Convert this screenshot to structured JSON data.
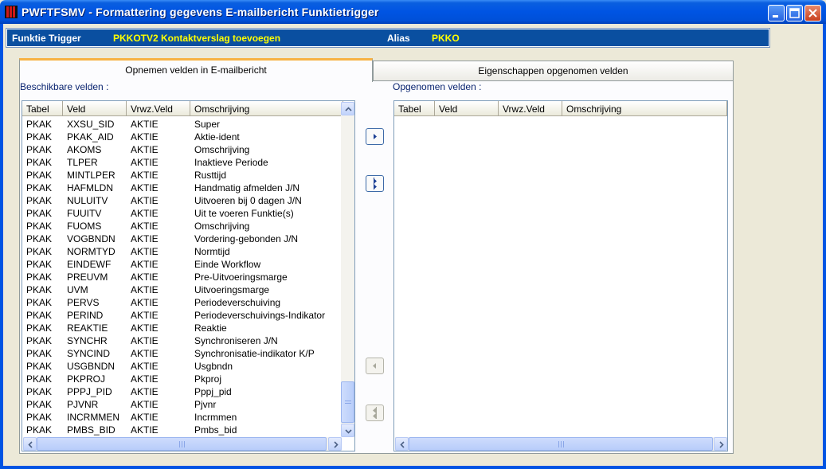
{
  "window": {
    "title": "PWFTFSMV - Formattering gegevens E-mailbericht Funktietrigger"
  },
  "infobar": {
    "function_label": "Funktie Trigger",
    "function_value": "PKKOTV2  Kontaktverslag toevoegen",
    "alias_label": "Alias",
    "alias_value": "PKKO"
  },
  "tabs": [
    {
      "label": "Opnemen velden in E-mailbericht",
      "active": true
    },
    {
      "label": "Eigenschappen opgenomen velden",
      "active": false
    }
  ],
  "available": {
    "label": "Beschikbare velden :",
    "columns": [
      "Tabel",
      "Veld",
      "Vrwz.Veld",
      "Omschrijving"
    ],
    "rows": [
      [
        "PKAK",
        "XXSU_SID",
        "AKTIE",
        "Super"
      ],
      [
        "PKAK",
        "PKAK_AID",
        "AKTIE",
        "Aktie-ident"
      ],
      [
        "PKAK",
        "AKOMS",
        "AKTIE",
        "Omschrijving"
      ],
      [
        "PKAK",
        "TLPER",
        "AKTIE",
        "Inaktieve Periode"
      ],
      [
        "PKAK",
        "MINTLPER",
        "AKTIE",
        "Rusttijd"
      ],
      [
        "PKAK",
        "HAFMLDN",
        "AKTIE",
        "Handmatig afmelden J/N"
      ],
      [
        "PKAK",
        "NULUITV",
        "AKTIE",
        "Uitvoeren bij 0 dagen J/N"
      ],
      [
        "PKAK",
        "FUUITV",
        "AKTIE",
        "Uit te voeren Funktie(s)"
      ],
      [
        "PKAK",
        "FUOMS",
        "AKTIE",
        "Omschrijving"
      ],
      [
        "PKAK",
        "VOGBNDN",
        "AKTIE",
        "Vordering-gebonden J/N"
      ],
      [
        "PKAK",
        "NORMTYD",
        "AKTIE",
        "Normtijd"
      ],
      [
        "PKAK",
        "EINDEWF",
        "AKTIE",
        "Einde Workflow"
      ],
      [
        "PKAK",
        "PREUVM",
        "AKTIE",
        "Pre-Uitvoeringsmarge"
      ],
      [
        "PKAK",
        "UVM",
        "AKTIE",
        "Uitvoeringsmarge"
      ],
      [
        "PKAK",
        "PERVS",
        "AKTIE",
        "Periodeverschuiving"
      ],
      [
        "PKAK",
        "PERIND",
        "AKTIE",
        "Periodeverschuivings-Indikator"
      ],
      [
        "PKAK",
        "REAKTIE",
        "AKTIE",
        "Reaktie"
      ],
      [
        "PKAK",
        "SYNCHR",
        "AKTIE",
        "Synchroniseren J/N"
      ],
      [
        "PKAK",
        "SYNCIND",
        "AKTIE",
        "Synchronisatie-indikator K/P"
      ],
      [
        "PKAK",
        "USGBNDN",
        "AKTIE",
        "Usgbndn"
      ],
      [
        "PKAK",
        "PKPROJ",
        "AKTIE",
        "Pkproj"
      ],
      [
        "PKAK",
        "PPPJ_PID",
        "AKTIE",
        "Pppj_pid"
      ],
      [
        "PKAK",
        "PJVNR",
        "AKTIE",
        "Pjvnr"
      ],
      [
        "PKAK",
        "INCRMMEN",
        "AKTIE",
        "Incrmmen"
      ],
      [
        "PKAK",
        "PMBS_BID",
        "AKTIE",
        "Pmbs_bid"
      ]
    ]
  },
  "selected": {
    "label": "Opgenomen velden :",
    "columns": [
      "Tabel",
      "Veld",
      "Vrwz.Veld",
      "Omschrijving"
    ],
    "rows": []
  },
  "transfer_buttons": [
    {
      "name": "add-selected-button",
      "icon": "arrow-right-icon",
      "enabled": true
    },
    {
      "name": "add-all-button",
      "icon": "double-arrow-right-icon",
      "enabled": true
    },
    {
      "name": "remove-selected-button",
      "icon": "arrow-left-icon",
      "enabled": false
    },
    {
      "name": "remove-all-button",
      "icon": "double-arrow-left-icon",
      "enabled": false
    }
  ],
  "colors": {
    "titlebar": "#0054e3",
    "infobar": "#0a4fa0",
    "infobar_value": "#ffff00",
    "tab_highlight": "#f7b244"
  }
}
